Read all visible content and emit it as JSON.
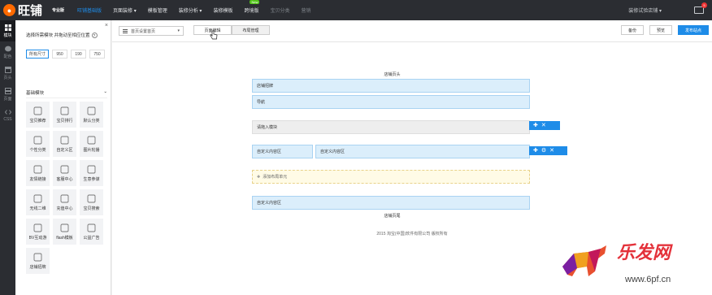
{
  "topbar": {
    "brand": "旺铺",
    "edition": "专业版",
    "nav": [
      {
        "label": "旺铺基础版",
        "state": "active"
      },
      {
        "label": "页面装修",
        "state": "normal",
        "chevron": "▾"
      },
      {
        "label": "模板管理",
        "state": "normal"
      },
      {
        "label": "装修分析",
        "state": "normal",
        "chevron": "▾"
      },
      {
        "label": "装修模板",
        "state": "normal"
      },
      {
        "label": "跨境版",
        "state": "normal",
        "badge": "New"
      },
      {
        "label": "宝贝分类",
        "state": "dim"
      },
      {
        "label": "营销",
        "state": "dim"
      }
    ],
    "shop_selector": "装修试验店铺",
    "shop_chevron": "▾",
    "mail_count": "5"
  },
  "leftbar": {
    "items": [
      {
        "label": "模块",
        "icon": "grid-icon",
        "active": true
      },
      {
        "label": "配色",
        "icon": "palette-icon",
        "active": false
      },
      {
        "label": "页头",
        "icon": "header-icon",
        "active": false
      },
      {
        "label": "页面",
        "icon": "page-icon",
        "active": false
      },
      {
        "label": "CSS",
        "icon": "code-icon",
        "active": false
      }
    ]
  },
  "panel": {
    "close": "×",
    "hint": "选择所需模块   并拖动至相应位置",
    "hint_q": "?",
    "widths": [
      "所有尺寸",
      "950",
      "190",
      "750"
    ],
    "section": "基础模块",
    "section_chevron": "⌄",
    "modules": [
      "宝贝推荐",
      "宝贝排行",
      "默认分类",
      "个性分类",
      "自定义区",
      "图片轮播",
      "友情链接",
      "客服中心",
      "生意参谋",
      "无线二维",
      "充值中心",
      "宝贝搜索",
      "BV互动游",
      "flash模板",
      "公益广告",
      "店铺招牌"
    ]
  },
  "toolbar": {
    "page_select": "首页设置首页",
    "page_select_chevron": "▾",
    "tab_edit": "页面编辑",
    "tab_layout": "布局管理",
    "btn_backup": "备份",
    "btn_preview": "预览",
    "btn_publish": "发布站点"
  },
  "canvas": {
    "header_caption": "店铺页头",
    "shop_sign": "店铺招牌",
    "nav": "导航",
    "insert_module": "请拖入模块",
    "custom_left": "自定义内容区",
    "custom_right": "自定义内容区",
    "add_layout": "添加布局单元",
    "custom_bottom": "自定义内容区",
    "footer_caption": "店铺页尾",
    "plus": "✚",
    "cross": "✕",
    "gear": "⚙"
  },
  "footer": {
    "copyright": "2015 淘宝(中国)软件有限公司 版权所有"
  },
  "watermark": {
    "text": "乐发网",
    "url": "www.6pf.cn"
  }
}
